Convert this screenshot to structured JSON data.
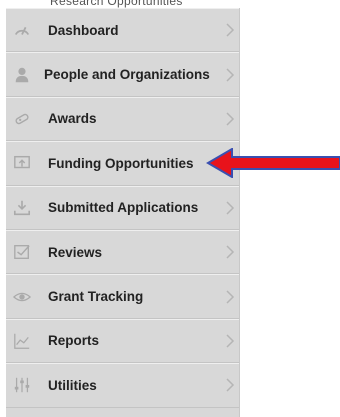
{
  "header": {
    "cut_text": "Research Opportunities"
  },
  "sidebar": {
    "items": [
      {
        "label": "Dashboard",
        "icon": "dashboard-gauge-icon"
      },
      {
        "label": "People and Organizations",
        "icon": "person-icon"
      },
      {
        "label": "Awards",
        "icon": "ribbon-icon"
      },
      {
        "label": "Funding Opportunities",
        "icon": "funding-screen-icon"
      },
      {
        "label": "Submitted Applications",
        "icon": "download-tray-icon"
      },
      {
        "label": "Reviews",
        "icon": "checkbox-icon"
      },
      {
        "label": "Grant Tracking",
        "icon": "eye-icon"
      },
      {
        "label": "Reports",
        "icon": "line-chart-icon"
      },
      {
        "label": "Utilities",
        "icon": "sliders-icon"
      }
    ]
  },
  "annotation": {
    "arrow_color": "#e8131b",
    "outline_color": "#3a4fb0",
    "target": "Funding Opportunities"
  },
  "colors": {
    "panel_bg": "#d8d8d8",
    "icon_color": "#aaaaaa",
    "text_color": "#222222"
  }
}
